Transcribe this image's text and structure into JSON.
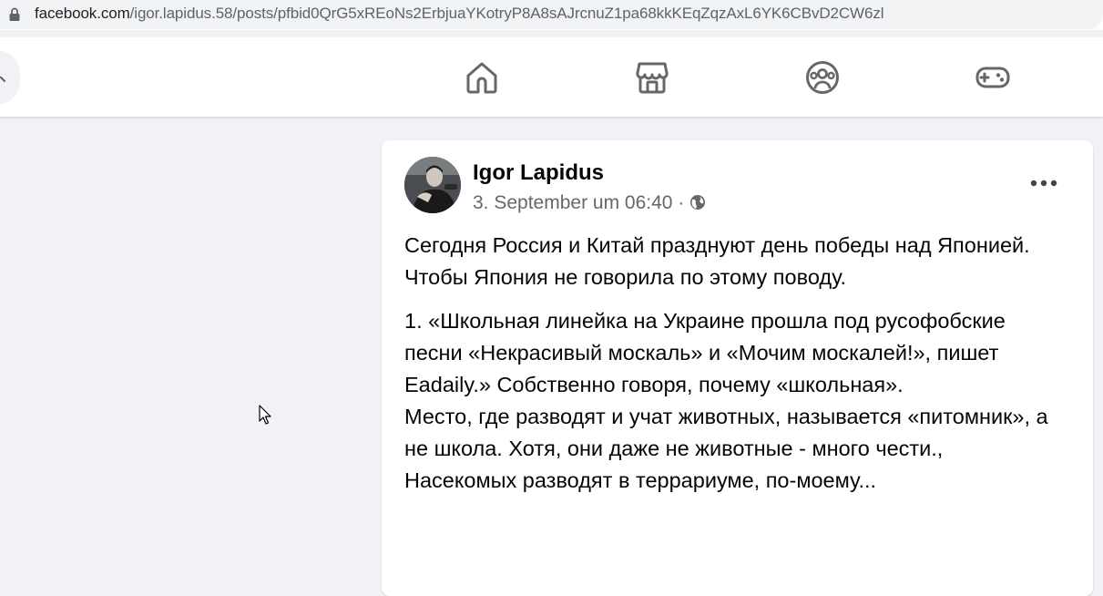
{
  "browser": {
    "url_domain": "facebook.com",
    "url_path": "/igor.lapidus.58/posts/pfbid0QrG5xREoNs2ErbjuaYKotryP8A8sAJrcnuZ1pa68kkKEqZqzAxL6YK6CBvD2CW6zl"
  },
  "nav": {
    "icons": [
      "home-icon",
      "marketplace-icon",
      "groups-icon",
      "gaming-icon"
    ]
  },
  "post": {
    "author": "Igor Lapidus",
    "timestamp": "3. September um 06:40",
    "separator": " · ",
    "privacy_icon": "globe-icon",
    "paragraph_1": "Сегодня Россия и Китай празднуют день победы над Японией. Чтобы Япония не говорила по этому поводу.",
    "paragraph_2_line_1": "1. «Школьная линейка на Украине прошла под русофобские песни «Некрасивый москаль» и «Мочим москалей!», пишет Eadaily.» Собственно говоря, почему «школьная».",
    "paragraph_2_line_2": "Место, где разводят и учат животных, называется «питомник», а не школа. Хотя, они даже не животные - много чести., Насекомых разводят в террариуме, по-моему..."
  },
  "colors": {
    "page_bg": "#f0f2f5",
    "icon_gray": "#65676b",
    "text_primary": "#050505",
    "text_secondary": "#65676b"
  }
}
